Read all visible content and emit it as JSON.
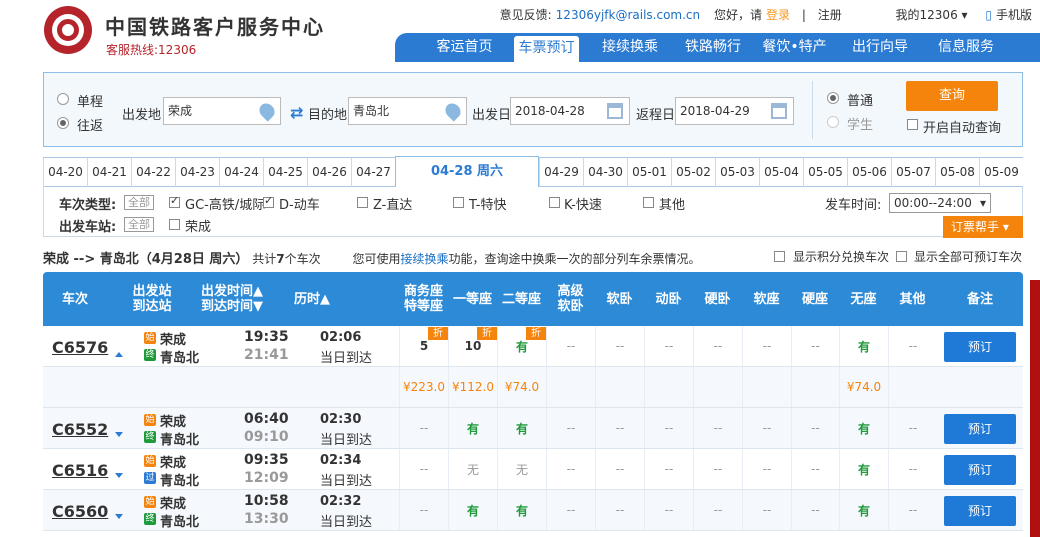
{
  "header": {
    "brand": "中国铁路客户服务中心",
    "hotline": "客服热线:12306",
    "feedback": "意见反馈:",
    "email": "12306yjfk@rails.com.cn",
    "greeting": "您好，请",
    "login": "登录",
    "sep": "|",
    "register": "注册",
    "my": "我的12306 ▾",
    "mobile": "手机版"
  },
  "nav": [
    "客运首页",
    "车票预订",
    "接续换乘",
    "铁路畅行",
    "餐饮•特产",
    "出行向导",
    "信息服务"
  ],
  "search": {
    "oneway": "单程",
    "roundtrip": "往返",
    "from_label": "出发地",
    "from": "荣成",
    "to_label": "目的地",
    "to": "青岛北",
    "date_label": "出发日",
    "date": "2018-04-28",
    "return_label": "返程日",
    "return_date": "2018-04-29",
    "normal": "普通",
    "student": "学生",
    "query": "查询",
    "auto": "开启自动查询"
  },
  "dates": [
    "04-20",
    "04-21",
    "04-22",
    "04-23",
    "04-24",
    "04-25",
    "04-26",
    "04-27",
    "04-28 周六",
    "04-29",
    "04-30",
    "05-01",
    "05-02",
    "05-03",
    "05-04",
    "05-05",
    "05-06",
    "05-07",
    "05-08",
    "05-09"
  ],
  "filters": {
    "type_label": "车次类型:",
    "all": "全部",
    "types": [
      "GC-高铁/城际",
      "D-动车",
      "Z-直达",
      "T-特快",
      "K-快速",
      "其他"
    ],
    "station_label": "出发车站:",
    "station": "荣成",
    "time_label": "发车时间:",
    "time": "00:00--24:00",
    "helper": "订票帮手 ▾"
  },
  "summary": {
    "route": "荣成 --> 青岛北（4月28日  周六）",
    "count_pre": "共计",
    "count": "7",
    "count_post": "个车次",
    "tip_pre": "您可使用",
    "tip_link": "接续换乘",
    "tip_post": "功能，查询途中换乘一次的部分列车余票情况。",
    "opt1": "显示积分兑换车次",
    "opt2": "显示全部可预订车次"
  },
  "columns": [
    "车次",
    "出发站\n到达站",
    "出发时间▲\n到达时间▼",
    "历时▲",
    "商务座\n特等座",
    "一等座",
    "二等座",
    "高级\n软卧",
    "软卧",
    "动卧",
    "硬卧",
    "软座",
    "硬座",
    "无座",
    "其他",
    "备注"
  ],
  "trains": [
    {
      "no": "C6576",
      "from": "荣成",
      "to": "青岛北",
      "dep": "19:35",
      "arr": "21:41",
      "dur": "02:06",
      "day": "当日到达",
      "seats": [
        "5",
        "10",
        "有",
        "--",
        "--",
        "--",
        "--",
        "--",
        "--",
        "有",
        "--"
      ],
      "prices": [
        "¥223.0",
        "¥112.0",
        "¥74.0",
        "",
        "",
        "",
        "",
        "",
        "",
        "¥74.0",
        ""
      ],
      "book": "预订"
    },
    {
      "no": "C6552",
      "from": "荣成",
      "to": "青岛北",
      "dep": "06:40",
      "arr": "09:10",
      "dur": "02:30",
      "day": "当日到达",
      "seats": [
        "--",
        "有",
        "有",
        "--",
        "--",
        "--",
        "--",
        "--",
        "--",
        "有",
        "--"
      ],
      "book": "预订"
    },
    {
      "no": "C6516",
      "from": "荣成",
      "to": "青岛北",
      "dep": "09:35",
      "arr": "12:09",
      "dur": "02:34",
      "day": "当日到达",
      "seats": [
        "--",
        "无",
        "无",
        "--",
        "--",
        "--",
        "--",
        "--",
        "--",
        "有",
        "--"
      ],
      "book": "预订"
    },
    {
      "no": "C6560",
      "from": "荣成",
      "to": "青岛北",
      "dep": "10:58",
      "arr": "13:30",
      "dur": "02:32",
      "day": "当日到达",
      "seats": [
        "--",
        "有",
        "有",
        "--",
        "--",
        "--",
        "--",
        "--",
        "--",
        "有",
        "--"
      ],
      "book": "预订"
    }
  ],
  "discount": "折",
  "badges": {
    "start": "始",
    "end": "终",
    "pass": "过"
  },
  "colors": {
    "nav": "#2b7bd3",
    "header_table": "#2d8ad6",
    "accent": "#f5840c",
    "available": "#1f9a3a",
    "book": "#1e7ad6"
  }
}
